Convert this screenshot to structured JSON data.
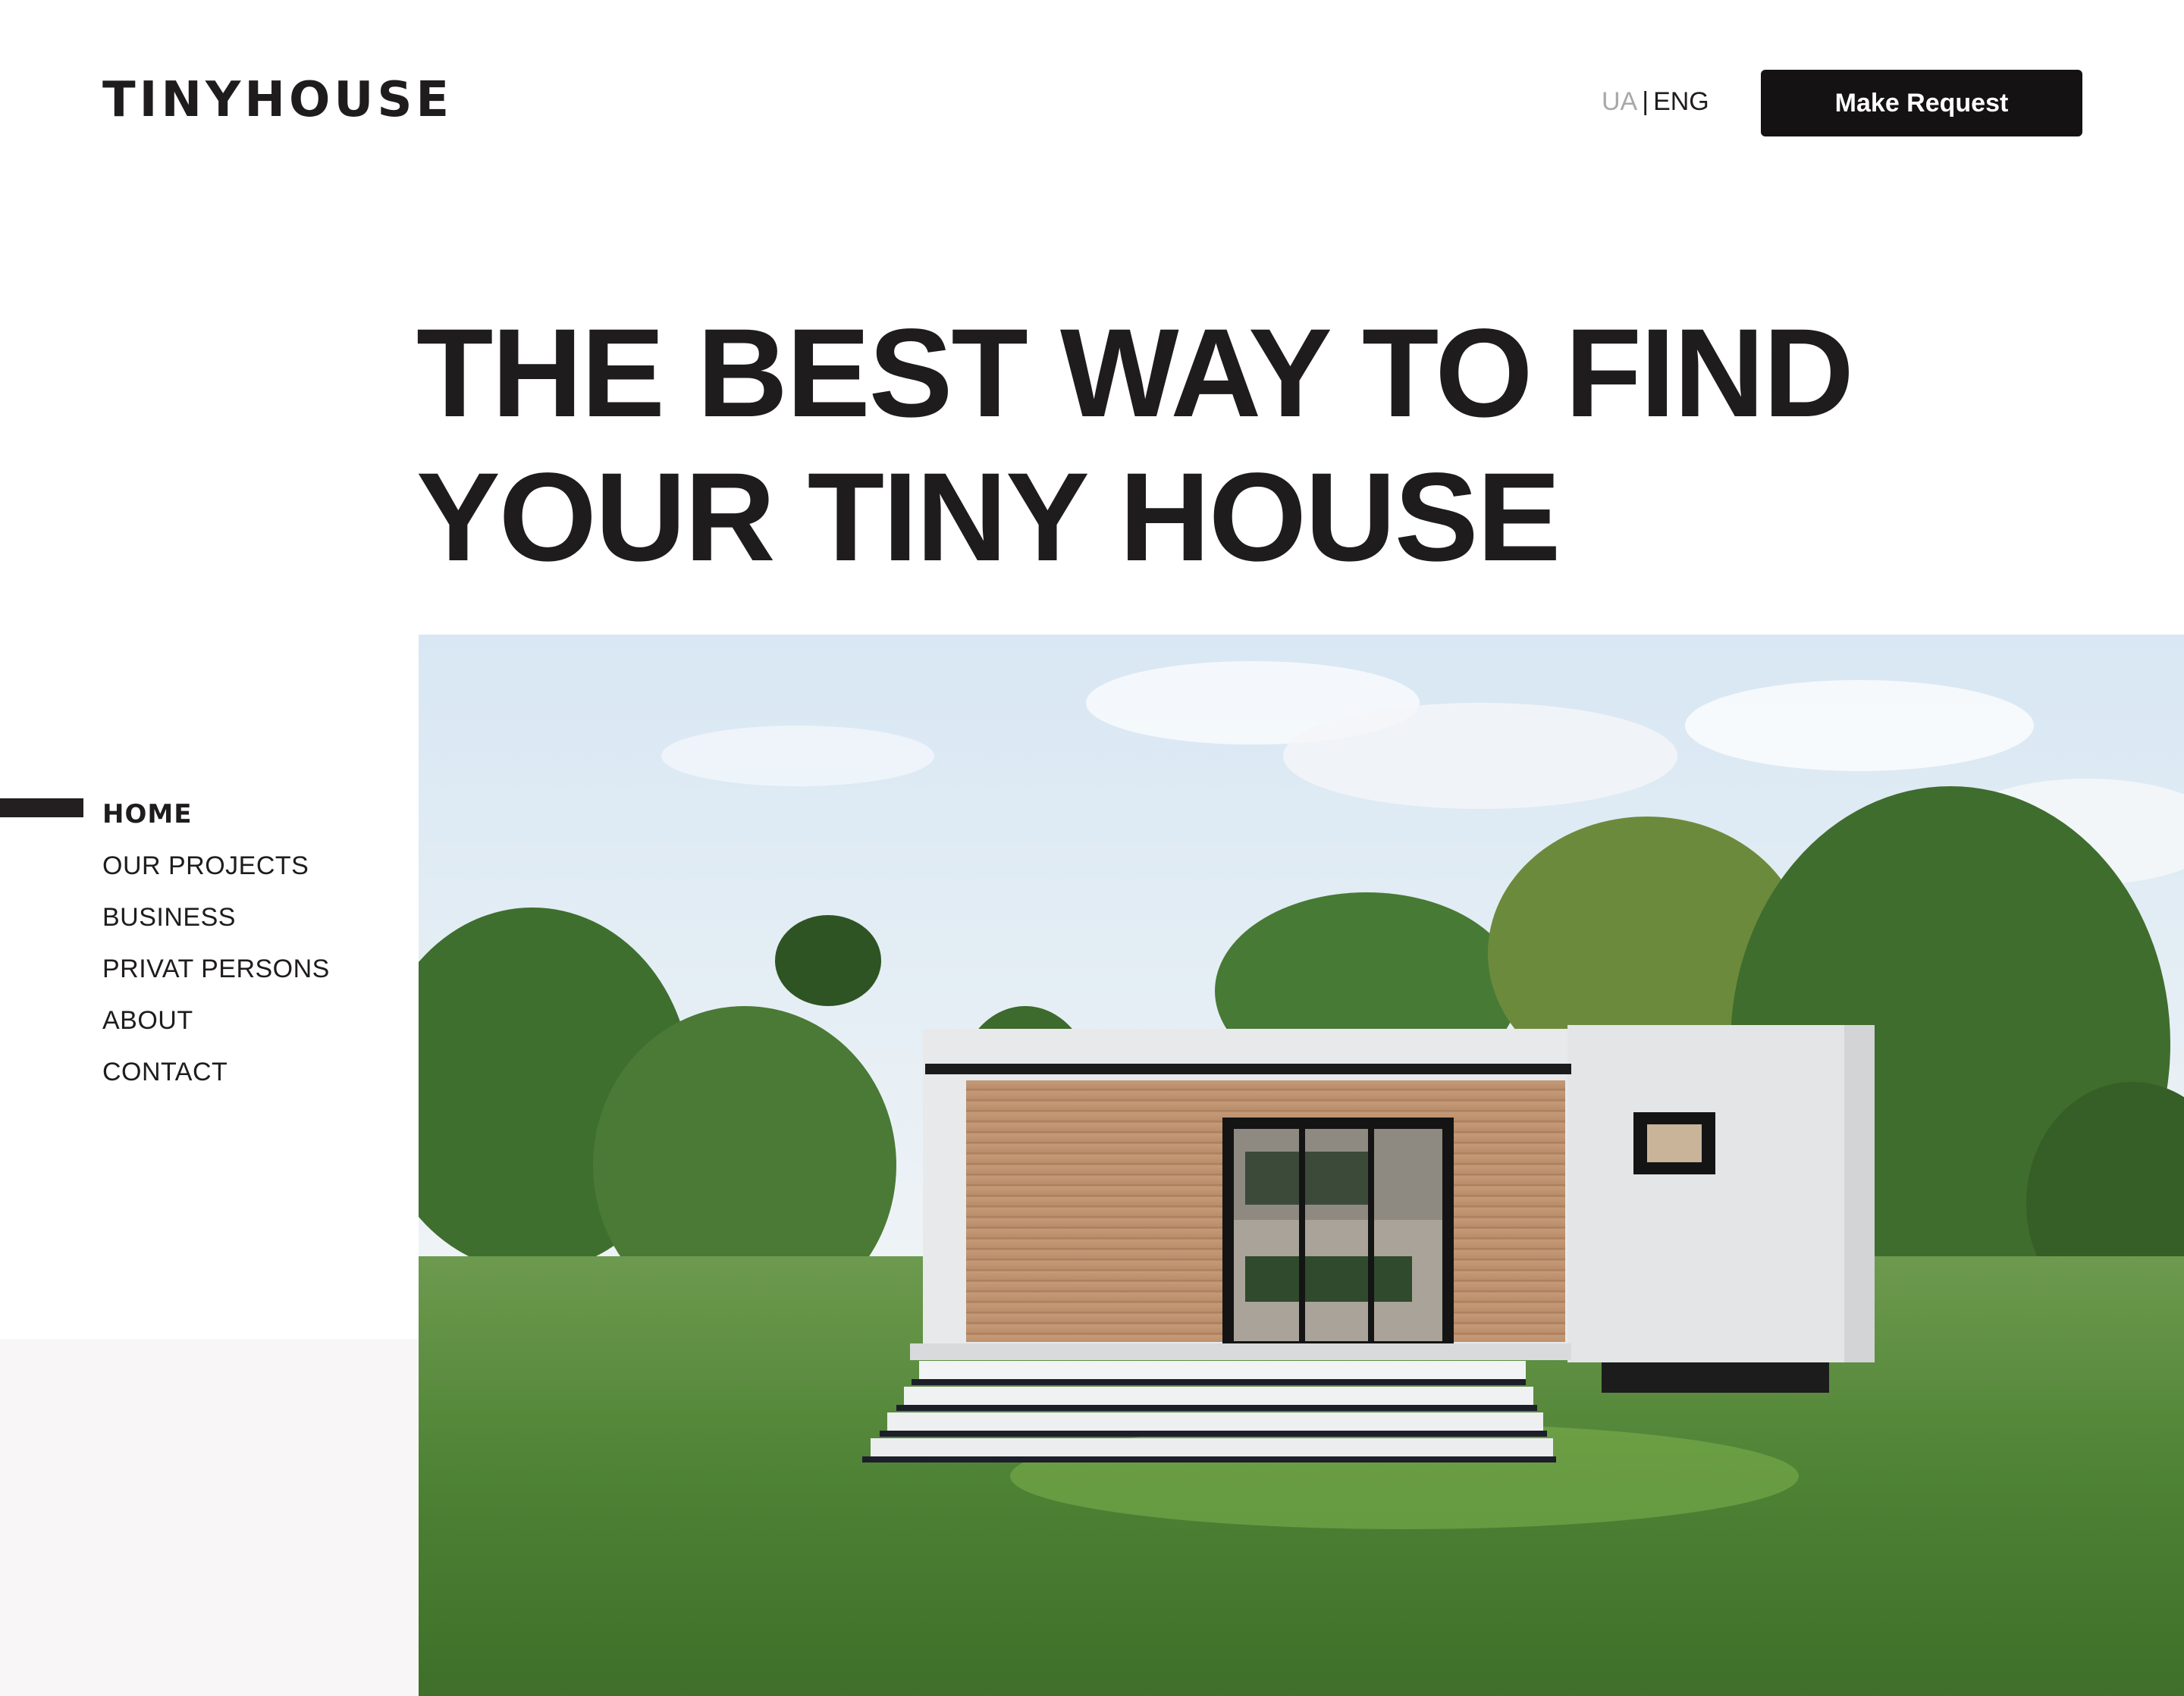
{
  "header": {
    "logo": "TINYHOUSE",
    "lang": {
      "ua": "UA",
      "separator": "|",
      "eng": "ENG"
    },
    "cta_label": "Make Request"
  },
  "hero": {
    "headline_line1": "THE BEST WAY TO FIND",
    "headline_line2": "YOUR TINY HOUSE"
  },
  "nav": {
    "items": [
      {
        "label": "HOME",
        "active": true
      },
      {
        "label": "OUR PROJECTS",
        "active": false
      },
      {
        "label": "BUSINESS",
        "active": false
      },
      {
        "label": "PRIVAT PERSONS",
        "active": false
      },
      {
        "label": "ABOUT",
        "active": false
      },
      {
        "label": "CONTACT",
        "active": false
      }
    ]
  },
  "colors": {
    "text": "#1f1c1d",
    "button_bg": "#141213",
    "button_text": "#ffffff",
    "muted": "#a8a8a8",
    "side_panel": "#f8f6f6"
  }
}
